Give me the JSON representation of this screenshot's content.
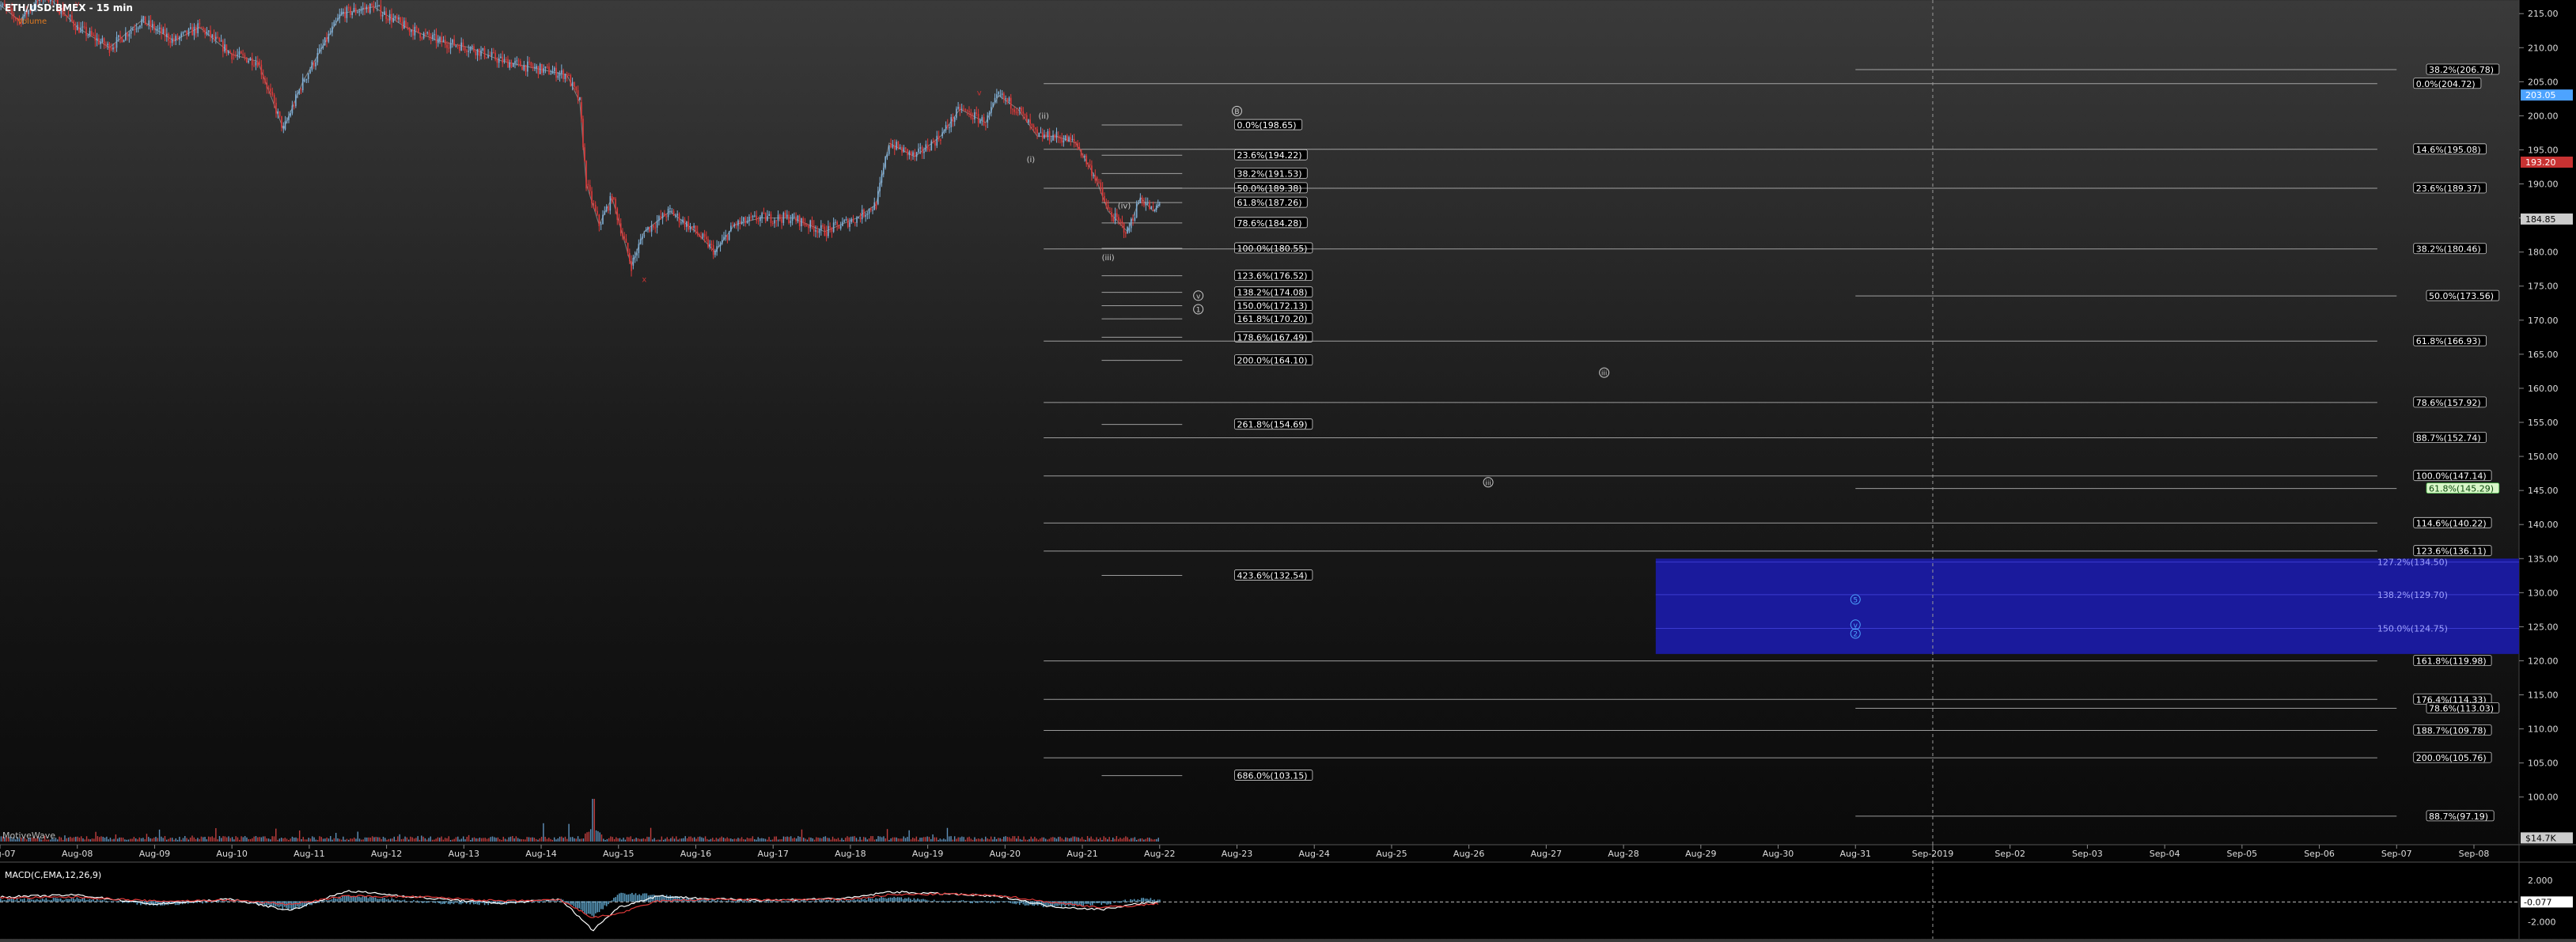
{
  "header": {
    "symbol_title": "ETH/USD:BMEX - 15 min",
    "volume_label": "Volume",
    "watermark": "MotiveWave"
  },
  "colors": {
    "up_candle": "#7fb0d8",
    "down_candle": "#e03a3a",
    "fib_line": "#c9c9c9",
    "label_bg": "#000000",
    "label_border": "#cfcfcf",
    "target_box": "#1a1a9c",
    "target_text": "#9fa2ff",
    "tag_red": "#c83232",
    "tag_blue": "#4da3ff",
    "tag_green": "#3fae3f",
    "macd_line": "#ffffff",
    "macd_signal": "#e03a3a",
    "macd_hist": "#68b6e0"
  },
  "chart_data": [
    {
      "type": "line",
      "title": "ETH/USD:BMEX - 15 min",
      "xlabel": "",
      "ylabel": "",
      "ylim": [
        93,
        217
      ],
      "y_ticks": [
        100,
        105,
        110,
        115,
        120,
        125,
        130,
        135,
        140,
        145,
        150,
        155,
        160,
        165,
        170,
        175,
        180,
        185,
        190,
        195,
        200,
        205,
        210,
        215
      ],
      "x_ticks": [
        "Aug-07",
        "Aug-08",
        "Aug-09",
        "Aug-10",
        "Aug-11",
        "Aug-12",
        "Aug-13",
        "Aug-14",
        "Aug-15",
        "Aug-16",
        "Aug-17",
        "Aug-18",
        "Aug-19",
        "Aug-20",
        "Aug-21",
        "Aug-22",
        "Aug-23",
        "Aug-24",
        "Aug-25",
        "Aug-26",
        "Aug-27",
        "Aug-28",
        "Aug-29",
        "Aug-30",
        "Aug-31",
        "Sep-2019",
        "Sep-02",
        "Sep-03",
        "Sep-04",
        "Sep-05",
        "Sep-06",
        "Sep-07",
        "Sep-08"
      ],
      "xlim": [
        "2019-08-07T00:00",
        "2019-09-08T14:00"
      ],
      "grid": false,
      "series": [
        {
          "x": [
            "2019-08-06T22:00",
            "2019-08-07T06:00",
            "2019-08-07T14:00",
            "2019-08-08T00:00",
            "2019-08-08T10:00",
            "2019-08-08T20:00",
            "2019-08-09T06:00",
            "2019-08-09T14:00",
            "2019-08-10T00:00",
            "2019-08-10T08:00",
            "2019-08-10T16:00",
            "2019-08-10T22:00",
            "2019-08-11T10:00",
            "2019-08-11T20:00",
            "2019-08-12T06:00",
            "2019-08-12T16:00",
            "2019-08-13T02:00",
            "2019-08-13T12:00",
            "2019-08-13T22:00",
            "2019-08-14T08:00",
            "2019-08-14T12:00",
            "2019-08-14T14:00",
            "2019-08-14T18:00",
            "2019-08-14T22:00",
            "2019-08-15T04:00",
            "2019-08-15T08:00",
            "2019-08-15T16:00",
            "2019-08-16T00:00",
            "2019-08-16T06:00",
            "2019-08-16T12:00",
            "2019-08-16T20:00",
            "2019-08-17T06:00",
            "2019-08-17T16:00",
            "2019-08-18T02:00",
            "2019-08-18T08:00",
            "2019-08-18T12:00",
            "2019-08-18T20:00",
            "2019-08-19T04:00",
            "2019-08-19T10:00",
            "2019-08-19T18:00",
            "2019-08-19T22:00",
            "2019-08-20T04:00",
            "2019-08-20T10:00",
            "2019-08-20T16:00",
            "2019-08-20T22:00",
            "2019-08-21T04:00",
            "2019-08-21T08:00",
            "2019-08-21T14:00",
            "2019-08-21T18:00",
            "2019-08-21T22:00",
            "2019-08-22T00:00"
          ],
          "values": [
            217,
            214,
            218,
            213,
            210,
            214,
            211,
            213,
            209,
            208,
            198,
            205,
            215,
            216,
            213,
            211,
            210,
            208,
            207,
            206,
            202,
            190,
            184,
            188,
            178,
            183,
            186,
            183,
            180,
            184,
            185,
            185,
            183,
            185,
            187,
            196,
            194,
            197,
            201,
            199,
            203,
            201,
            197,
            197,
            196,
            191,
            186,
            183,
            188,
            186,
            187
          ]
        }
      ],
      "volume_label": "Volume",
      "volume_spike_date": "2019-08-14T16:00",
      "wave_labels": [
        {
          "text": "v",
          "x": "2019-08-08T00:00",
          "y": 216.5,
          "color": "tag_red",
          "boxed": false
        },
        {
          "text": "v",
          "x": "2019-08-19T16:00",
          "y": 203.4,
          "color": "tag_red",
          "boxed": false
        },
        {
          "text": "x",
          "x": "2019-08-15T08:00",
          "y": 176.0,
          "color": "tag_red",
          "boxed": false
        },
        {
          "text": "(ii)",
          "x": "2019-08-20T12:00",
          "y": 200.0,
          "color": "tag_gray",
          "boxed": false
        },
        {
          "text": "(i)",
          "x": "2019-08-20T08:00",
          "y": 193.6,
          "color": "tag_gray",
          "boxed": false
        },
        {
          "text": "(iv)",
          "x": "2019-08-21T13:00",
          "y": 186.8,
          "color": "tag_gray",
          "boxed": false
        },
        {
          "text": "(iii)",
          "x": "2019-08-21T08:00",
          "y": 179.2,
          "color": "tag_gray",
          "boxed": false
        },
        {
          "text": "B",
          "x": "2019-08-23T00:00",
          "y": 200.7,
          "color": "tag_gray",
          "boxed": true
        },
        {
          "text": "iii",
          "x": "2019-08-27T18:00",
          "y": 162.3,
          "color": "tag_gray",
          "boxed": true
        },
        {
          "text": "iii",
          "x": "2019-08-26T06:00",
          "y": 146.2,
          "color": "tag_gray",
          "boxed": true
        },
        {
          "text": "v",
          "x": "2019-08-22T12:00",
          "y": 173.6,
          "color": "tag_gray",
          "boxed": true
        },
        {
          "text": "1",
          "x": "2019-08-22T12:00",
          "y": 171.6,
          "color": "tag_gray",
          "boxed": true
        },
        {
          "text": "5",
          "x": "2019-08-31T00:00",
          "y": 129.0,
          "color": "tag_blue",
          "boxed": true
        },
        {
          "text": "v",
          "x": "2019-08-31T00:00",
          "y": 125.3,
          "color": "tag_blue",
          "boxed": true
        },
        {
          "text": "2",
          "x": "2019-08-31T00:00",
          "y": 124.0,
          "color": "tag_blue",
          "boxed": true
        }
      ],
      "fib_groups": [
        {
          "line_start": "2019-08-21T06:00",
          "line_end": "2019-08-22T07:00",
          "label_x": "2019-08-23T00:00",
          "levels": [
            {
              "label": "0.0%(198.65)",
              "y": 198.65
            },
            {
              "label": "23.6%(194.22)",
              "y": 194.22
            },
            {
              "label": "38.2%(191.53)",
              "y": 191.53
            },
            {
              "label": "50.0%(189.38)",
              "y": 189.38
            },
            {
              "label": "61.8%(187.26)",
              "y": 187.26
            },
            {
              "label": "78.6%(184.28)",
              "y": 184.28
            },
            {
              "label": "100.0%(180.55)",
              "y": 180.55
            },
            {
              "label": "123.6%(176.52)",
              "y": 176.52
            },
            {
              "label": "138.2%(174.08)",
              "y": 174.08
            },
            {
              "label": "150.0%(172.13)",
              "y": 172.13
            },
            {
              "label": "161.8%(170.20)",
              "y": 170.2
            },
            {
              "label": "178.6%(167.49)",
              "y": 167.49
            },
            {
              "label": "200.0%(164.10)",
              "y": 164.1
            },
            {
              "label": "261.8%(154.69)",
              "y": 154.69
            },
            {
              "label": "423.6%(132.54)",
              "y": 132.54
            },
            {
              "label": "686.0%(103.15)",
              "y": 103.15
            }
          ]
        },
        {
          "line_start": "2019-08-20T12:00",
          "line_end": "2019-09-06T18:00",
          "label_x": "2019-09-07T06:00",
          "levels": [
            {
              "label": "0.0%(204.72)",
              "y": 204.72
            },
            {
              "label": "14.6%(195.08)",
              "y": 195.08
            },
            {
              "label": "23.6%(189.37)",
              "y": 189.37
            },
            {
              "label": "38.2%(180.46)",
              "y": 180.46
            },
            {
              "label": "61.8%(166.93)",
              "y": 166.93
            },
            {
              "label": "78.6%(157.92)",
              "y": 157.92
            },
            {
              "label": "88.7%(152.74)",
              "y": 152.74
            },
            {
              "label": "100.0%(147.14)",
              "y": 147.14
            },
            {
              "label": "114.6%(140.22)",
              "y": 140.22
            },
            {
              "label": "123.6%(136.11)",
              "y": 136.11
            },
            {
              "label": "161.8%(119.98)",
              "y": 119.98
            },
            {
              "label": "176.4%(114.33)",
              "y": 114.33
            },
            {
              "label": "188.7%(109.78)",
              "y": 109.78
            },
            {
              "label": "200.0%(105.76)",
              "y": 105.76
            }
          ]
        },
        {
          "line_start": "2019-08-31T00:00",
          "line_end": "2019-09-07T00:00",
          "label_x": "2019-09-07T10:00",
          "levels": [
            {
              "label": "38.2%(206.78)",
              "y": 206.78
            },
            {
              "label": "50.0%(173.56)",
              "y": 173.56
            },
            {
              "label": "61.8%(145.29)",
              "y": 145.29,
              "highlight": "green"
            },
            {
              "label": "78.6%(113.03)",
              "y": 113.03
            },
            {
              "label": "88.7%(97.19)",
              "y": 97.19
            }
          ]
        }
      ],
      "target_box": {
        "x_start": "2019-08-28T10:00",
        "x_end": "2019-09-09T00:00",
        "y_top": 135.0,
        "y_bottom": 121.0,
        "levels": [
          {
            "label": "127.2%(134.50)",
            "y": 134.5
          },
          {
            "label": "138.2%(129.70)",
            "y": 129.7
          },
          {
            "label": "150.0%(124.75)",
            "y": 124.75
          }
        ]
      },
      "vertical_marker_date": "2019-09-01T00:00",
      "price_tags": [
        {
          "text": "203.05",
          "y": 203.05,
          "color": "tag_blue"
        },
        {
          "text": "193.20",
          "y": 193.2,
          "color": "tag_red"
        },
        {
          "text": "184.85",
          "y": 184.85,
          "color": "tag_gray"
        },
        {
          "text": "$14.7K",
          "y": 94.0,
          "color": "tag_gray"
        }
      ]
    },
    {
      "type": "line",
      "title": "MACD(C,EMA,12,26,9)",
      "ylim": [
        -3.4,
        3.0
      ],
      "y_ticks": [
        -2.0,
        2.0
      ],
      "y_tick_labels": [
        "-2.000",
        "2.000"
      ],
      "reference_value": -0.077,
      "reference_label": "-0.077",
      "x": [
        "2019-08-07T00:00",
        "2019-08-08T00:00",
        "2019-08-09T00:00",
        "2019-08-10T00:00",
        "2019-08-10T18:00",
        "2019-08-11T12:00",
        "2019-08-12T12:00",
        "2019-08-13T12:00",
        "2019-08-14T06:00",
        "2019-08-14T16:00",
        "2019-08-15T00:00",
        "2019-08-15T12:00",
        "2019-08-16T06:00",
        "2019-08-17T00:00",
        "2019-08-18T00:00",
        "2019-08-18T12:00",
        "2019-08-19T06:00",
        "2019-08-20T00:00",
        "2019-08-20T14:00",
        "2019-08-21T06:00",
        "2019-08-21T18:00",
        "2019-08-22T00:00"
      ],
      "series": [
        {
          "values": [
            0.4,
            0.6,
            -0.3,
            0.2,
            -0.9,
            1.0,
            0.3,
            -0.2,
            0.2,
            -2.8,
            -0.6,
            0.5,
            0.2,
            0.1,
            0.3,
            0.9,
            0.7,
            0.4,
            -0.5,
            -0.8,
            -0.2,
            -0.1
          ]
        },
        {
          "values": [
            0.3,
            0.4,
            0.0,
            0.1,
            -0.3,
            0.5,
            0.4,
            0.0,
            0.1,
            -1.6,
            -1.2,
            0.0,
            0.2,
            0.1,
            0.2,
            0.6,
            0.7,
            0.5,
            -0.1,
            -0.6,
            -0.4,
            -0.2
          ]
        }
      ]
    }
  ]
}
